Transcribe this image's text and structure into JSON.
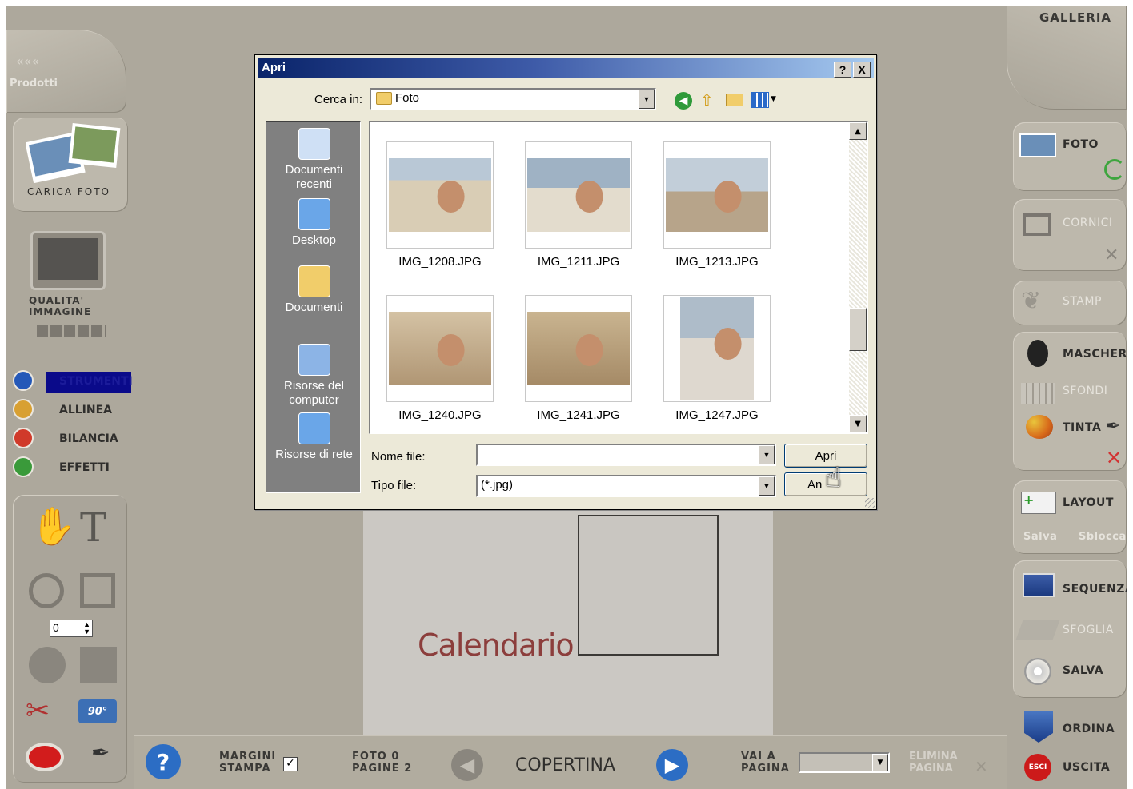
{
  "app": {
    "gallery_title": "GALLERIA",
    "products_label": "Prodotti",
    "load_photo": "CARICA FOTO",
    "quality_label": "QUALITA'\nIMMAGINE",
    "tools": [
      {
        "label": "STRUMENTI",
        "icon": "cursor-icon",
        "color": "#2458b8"
      },
      {
        "label": "ALLINEA",
        "icon": "align-icon",
        "color": "#d8a032"
      },
      {
        "label": "BILANCIA",
        "icon": "balance-icon",
        "color": "#d03a2a"
      },
      {
        "label": "EFFETTI",
        "icon": "effects-icon",
        "color": "#3a9a3a"
      }
    ],
    "stepper_value": "0",
    "canvas_title": "Calendario",
    "bottom": {
      "margins_label1": "MARGINI",
      "margins_label2": "STAMPA",
      "photo_count": "FOTO 0",
      "page_count": "PAGINE 2",
      "cover_label": "COPERTINA",
      "goto_label1": "VAI A",
      "goto_label2": "PAGINA",
      "delete_label1": "ELIMINA",
      "delete_label2": "PAGINA"
    },
    "right": {
      "foto": "FOTO",
      "cornici": "CORNICI",
      "stamp": "STAMP",
      "maschere": "MASCHERE",
      "sfondi": "SFONDI",
      "tinta": "TINTA",
      "layout": "LAYOUT",
      "salva_layout": "Salva",
      "sblocca": "Sblocca",
      "sequenza": "SEQUENZA",
      "sfoglia": "SFOGLIA",
      "salva": "SALVA",
      "ordina": "ORDINA",
      "uscita": "USCITA",
      "uscita_badge": "ESCI"
    }
  },
  "dialog": {
    "title": "Apri",
    "help": "?",
    "close": "X",
    "look_in_label": "Cerca in:",
    "look_in_value": "Foto",
    "places": [
      {
        "label": "Documenti recenti",
        "icon": "recent-documents-icon"
      },
      {
        "label": "Desktop",
        "icon": "desktop-icon"
      },
      {
        "label": "Documenti",
        "icon": "documents-folder-icon"
      },
      {
        "label": "Risorse del computer",
        "icon": "my-computer-icon"
      },
      {
        "label": "Risorse di rete",
        "icon": "network-icon"
      }
    ],
    "files": [
      {
        "name": "IMG_1208.JPG"
      },
      {
        "name": "IMG_1211.JPG"
      },
      {
        "name": "IMG_1213.JPG"
      },
      {
        "name": "IMG_1240.JPG"
      },
      {
        "name": "IMG_1241.JPG"
      },
      {
        "name": "IMG_1247.JPG"
      }
    ],
    "filename_label": "Nome file:",
    "filename_value": "",
    "filetype_label": "Tipo file:",
    "filetype_value": "(*.jpg)",
    "open_button": "Apri",
    "cancel_button": "An"
  }
}
